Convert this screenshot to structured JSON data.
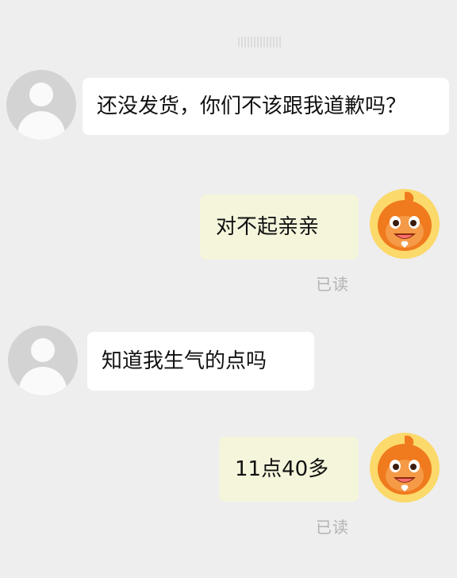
{
  "conversation": {
    "messages": [
      {
        "from": "customer",
        "text": "还没发货，你们不该跟我道歉吗？"
      },
      {
        "from": "shop",
        "text": "对不起亲亲",
        "status": "已读"
      },
      {
        "from": "customer",
        "text": "知道我生气的点吗"
      },
      {
        "from": "shop",
        "text": "11点40多",
        "status": "已读"
      }
    ]
  },
  "icons": {
    "customer_avatar": "default-person-avatar-icon",
    "shop_avatar": "orange-mascot-avatar-icon"
  },
  "colors": {
    "background": "#eeeeee",
    "incoming_bubble": "#ffffff",
    "outgoing_bubble": "#f5f5dc",
    "read_status": "#b3b3b3",
    "mascot_orange": "#f07a1e"
  }
}
